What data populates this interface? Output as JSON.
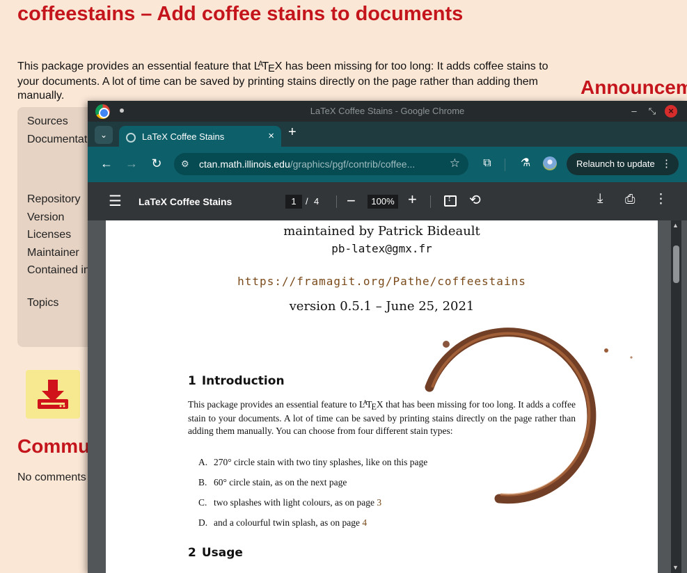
{
  "background_page": {
    "title": "coffeestains – Add coffee stains to documents",
    "description_before": "This package provides an essential feature that ",
    "latex_logo": "LaTeX",
    "description_after": " has been missing for too long: It adds coffee stains to your documents. A lot of time can be saved by printing stains directly on the page rather than adding them manually.",
    "announcements_heading": "Announcem",
    "info_labels": [
      "Sources",
      "Documentati",
      "Repository",
      "Version",
      "Licenses",
      "Maintainer",
      "Contained in",
      "Topics"
    ],
    "community_heading": "Commu",
    "no_comments_text": "No comments"
  },
  "window": {
    "title": "LaTeX Coffee Stains - Google Chrome",
    "minimize_glyph": "–",
    "maximize_glyph": "⤡",
    "close_glyph": "×"
  },
  "tab": {
    "title": "LaTeX Coffee Stains",
    "close_glyph": "×",
    "new_tab_glyph": "+",
    "tab_search_glyph": "⌄"
  },
  "toolbar": {
    "back_glyph": "←",
    "forward_glyph": "→",
    "reload_glyph": "↻",
    "url_host": "ctan.math.illinois.edu",
    "url_path": "/graphics/pgf/contrib/coffee...",
    "star_glyph": "☆",
    "relaunch_label": "Relaunch to update",
    "more_glyph": "⋮"
  },
  "pdf_viewer": {
    "doc_title": "LaTeX Coffee Stains",
    "current_page": "1",
    "page_separator": "/",
    "total_pages": "4",
    "zoom_level": "100%",
    "zoom_out_glyph": "−",
    "zoom_in_glyph": "+",
    "menu_glyph": "☰",
    "rotate_glyph": "⟲",
    "download_glyph": "⤓",
    "print_glyph": "⎙",
    "more_glyph": "⋮"
  },
  "pdf_page": {
    "maintainer_line": "maintained by Patrick Bideault",
    "email": "pb-latex@gmx.fr",
    "project_url": "https://framagit.org/Pathe/coffeestains",
    "version_line": "version 0.5.1 – June 25, 2021",
    "section1_number": "1",
    "section1_title": "Introduction",
    "intro_before": "This package provides an essential feature to ",
    "intro_logo": "LaTeX",
    "intro_after": " that has been missing for too long. It adds a coffee stain to your documents. A lot of time can be saved by printing stains directly on the page rather than adding them manually. You can choose from four different stain types:",
    "list": [
      {
        "marker": "A.",
        "text": "270° circle stain with two tiny splashes, like on this page",
        "ref": ""
      },
      {
        "marker": "B.",
        "text": "60° circle stain, as on the next page",
        "ref": ""
      },
      {
        "marker": "C.",
        "text": "two splashes with light colours, as on page ",
        "ref": "3"
      },
      {
        "marker": "D.",
        "text": "and a colourful twin splash, as on page ",
        "ref": "4"
      }
    ],
    "section2_number": "2",
    "section2_title": "Usage"
  },
  "colors": {
    "page_background": "#fbe7d6",
    "ctan_red": "#c4151c",
    "chrome_teal": "#0d5f6a",
    "pdf_toolbar": "#323639",
    "stain_brown": "#7b3412",
    "link_brown": "#7a4a1a"
  }
}
